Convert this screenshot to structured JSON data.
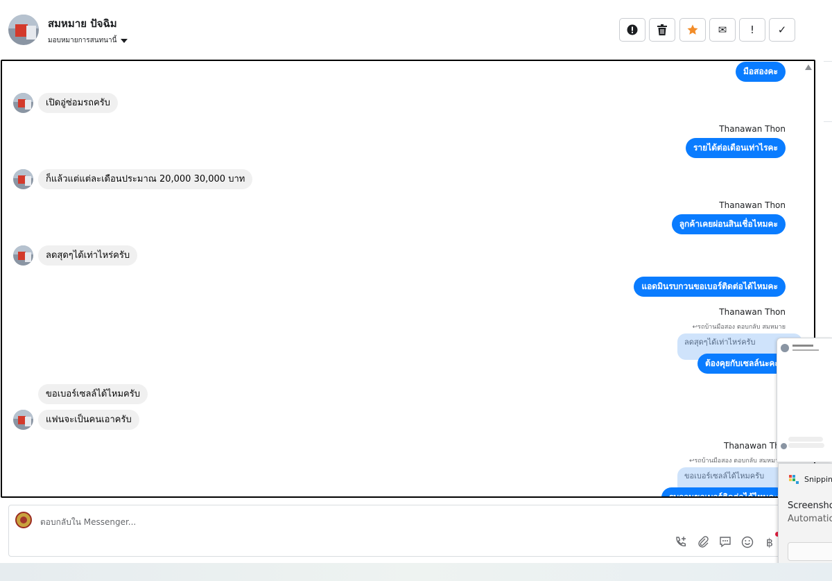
{
  "header": {
    "name": "สมหมาย ปัจฉิม",
    "assign_label": "มอบหมายการสนทนานี้"
  },
  "toolbar": {
    "buttons": [
      {
        "name": "report-button",
        "icon": "exclamation-circle-icon"
      },
      {
        "name": "delete-button",
        "icon": "trash-icon"
      },
      {
        "name": "star-button",
        "icon": "star-icon"
      },
      {
        "name": "mark-unread-button",
        "icon": "envelope-icon",
        "glyph": "✉"
      },
      {
        "name": "important-button",
        "icon": "exclamation-icon",
        "glyph": "!"
      },
      {
        "name": "done-button",
        "icon": "check-icon",
        "glyph": "✓"
      }
    ],
    "star_color": "#f28c28"
  },
  "chat": {
    "messages": [
      {
        "dir": "out",
        "text": "มือสองคะ"
      },
      {
        "dir": "in",
        "text": "เปิดอู่ซ่อมรถครับ"
      },
      {
        "dir": "out",
        "sender": "Thanawan Thon",
        "text": "รายได้ต่อเดือนเท่าไรคะ"
      },
      {
        "dir": "in",
        "text": "ก็แล้วแต่แต่ละเดือนประมาณ 20,000 30,000 บาท"
      },
      {
        "dir": "out",
        "sender": "Thanawan Thon",
        "text": "ลูกค้าเคยผ่อนสินเชื่อไหมคะ"
      },
      {
        "dir": "in",
        "text": "ลดสุดๆได้เท่าไหร่ครับ"
      },
      {
        "dir": "out",
        "text": "แอดมินรบกวนขอเบอร์ติดต่อได้ไหมคะ"
      },
      {
        "dir": "out",
        "sender": "Thanawan Thon",
        "reply_meta": "↩รถบ้านมือสอง ตอบกลับ สมหมาย",
        "quote": "ลดสุดๆได้เท่าไหร่ครับ",
        "text": "ต้องคุยกับเซลล์นะคะ"
      },
      {
        "dir": "in",
        "text": "ขอเบอร์เซลล์ได้ไหมครับ"
      },
      {
        "dir": "in",
        "text": "แฟนจะเป็นคนเอาครับ"
      },
      {
        "dir": "out",
        "sender": "Thanawan Thon",
        "reply_meta": "↩รถบ้านมือสอง ตอบกลับ สมหมาย",
        "quote": "ขอเบอร์เซลล์ได้ไหมครับ",
        "text": "รบกวนขอเบอร์ติดต่อได้ไหมคะ"
      }
    ],
    "colors": {
      "out_bubble": "#0a7cff",
      "in_bubble": "#f0f0f0",
      "quote_bubble": "#cfe3fb"
    }
  },
  "composer": {
    "placeholder": "ตอบกลับใน Messenger...",
    "tools": [
      "phone-plus-icon",
      "paperclip-icon",
      "speech-bubble-icon",
      "emoji-icon",
      "baht-icon"
    ],
    "baht_glyph": "฿"
  },
  "snipping": {
    "app_name": "Snipping Tool",
    "title": "Screenshot copied to clipboard",
    "subtitle": "Automatically saved to screenshots folder"
  }
}
